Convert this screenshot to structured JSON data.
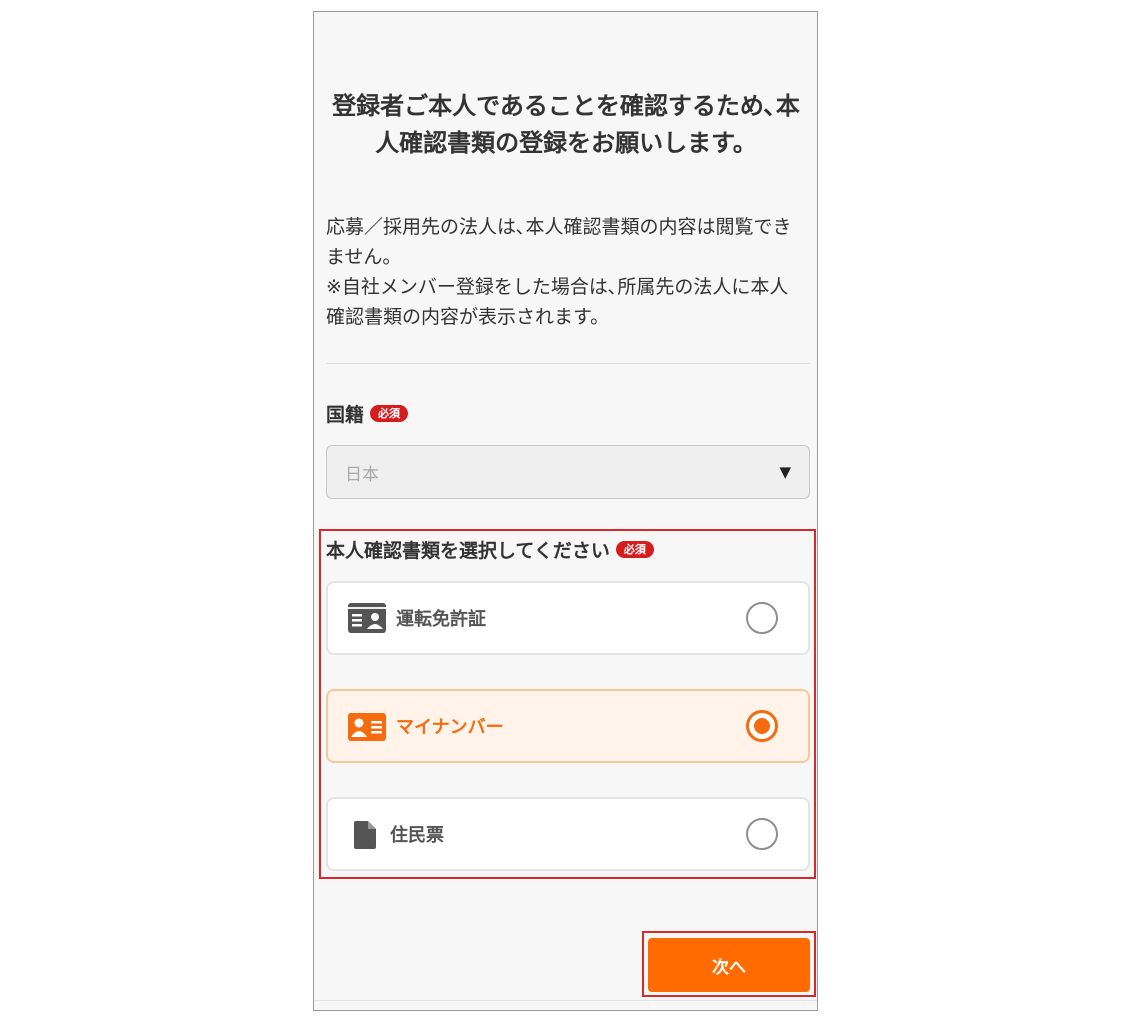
{
  "header": {
    "title": "登録者ご本人であることを確認するため､本人確認書類の登録をお願いします。"
  },
  "description": {
    "line1": "応募／採用先の法人は､本人確認書類の内容は閲覧できません。",
    "line2": "※自社メンバー登録をした場合は､所属先の法人に本人確認書類の内容が表示されます。"
  },
  "nationality": {
    "label": "国籍",
    "required_badge": "必須",
    "selected_value": "日本",
    "arrow_glyph": "▼"
  },
  "documents": {
    "label": "本人確認書類を選択してください",
    "required_badge": "必須",
    "options": [
      {
        "label": "運転免許証",
        "icon": "id-card-icon",
        "selected": false
      },
      {
        "label": "マイナンバー",
        "icon": "my-number-card-icon",
        "selected": true
      },
      {
        "label": "住民票",
        "icon": "document-icon",
        "selected": false
      }
    ]
  },
  "footer": {
    "next_label": "次へ"
  },
  "colors": {
    "accent": "#ff6b00",
    "selected_text": "#f66b0e",
    "selected_bg": "#fff3ea",
    "required_badge": "#d61d1d",
    "annotation_box": "#d32a2a"
  }
}
